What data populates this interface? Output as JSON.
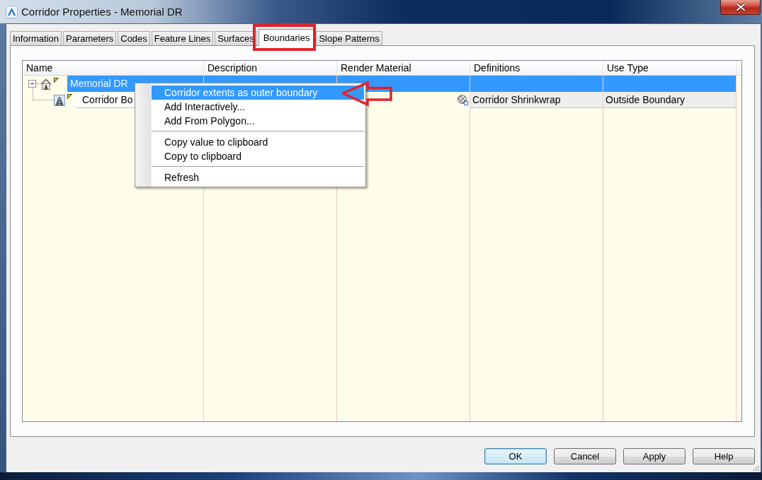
{
  "window": {
    "title": "Corridor Properties - Memorial DR"
  },
  "tabs": [
    {
      "label": "Information",
      "selected": false
    },
    {
      "label": "Parameters",
      "selected": false
    },
    {
      "label": "Codes",
      "selected": false
    },
    {
      "label": "Feature Lines",
      "selected": false
    },
    {
      "label": "Surfaces",
      "selected": false
    },
    {
      "label": "Boundaries",
      "selected": true
    },
    {
      "label": "Slope Patterns",
      "selected": false
    }
  ],
  "table": {
    "columns": [
      "Name",
      "Description",
      "Render Material",
      "Definitions",
      "Use Type"
    ],
    "rows": [
      {
        "kind": "corridor",
        "name": "Memorial DR",
        "selected": true,
        "expanded": true,
        "children": [
          {
            "kind": "boundary",
            "name": "Corridor Bo",
            "selected": false,
            "definitions": "Corridor Shrinkwrap",
            "use_type": "Outside Boundary"
          }
        ]
      }
    ]
  },
  "context_menu": {
    "items": [
      {
        "kind": "item",
        "label": "Corridor extents as outer boundary",
        "highlighted": true
      },
      {
        "kind": "item",
        "label": "Add Interactively...",
        "highlighted": false
      },
      {
        "kind": "item",
        "label": "Add From Polygon...",
        "highlighted": false
      },
      {
        "kind": "separator"
      },
      {
        "kind": "item",
        "label": "Copy value to clipboard",
        "highlighted": false
      },
      {
        "kind": "item",
        "label": "Copy to clipboard",
        "highlighted": false
      },
      {
        "kind": "separator"
      },
      {
        "kind": "item",
        "label": "Refresh",
        "highlighted": false
      }
    ]
  },
  "buttons": [
    {
      "label": "OK",
      "default": true
    },
    {
      "label": "Cancel",
      "default": false
    },
    {
      "label": "Apply",
      "default": false
    },
    {
      "label": "Help",
      "default": false
    }
  ]
}
